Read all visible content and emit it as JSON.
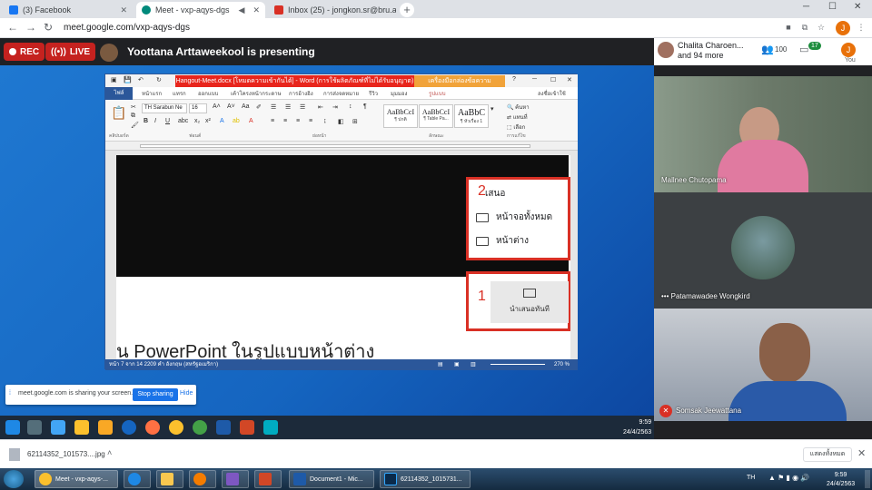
{
  "browser": {
    "tabs": [
      {
        "title": "(3) Facebook",
        "color": "#1877f2"
      },
      {
        "title": "Meet - vxp-aqys-dgs",
        "color": "#00897b"
      },
      {
        "title": "Inbox (25) - jongkon.sr@bru.ac.th",
        "color": "#d93025"
      }
    ],
    "url": "meet.google.com/vxp-aqys-dgs",
    "profile_initial": "J"
  },
  "meet": {
    "rec_label": "REC",
    "live_label": "LIVE",
    "presenter_text": "Yoottana Arttaweekool is presenting",
    "top_participant": "Chalita Charoen...",
    "others_count": "and 94 more",
    "people_count": "100",
    "chat_count": "17",
    "you_label": "You",
    "you_initial": "J",
    "participants": [
      {
        "name": "Mallnee Chutopama"
      },
      {
        "name": "Patamawadee Wongkird"
      },
      {
        "name": "Somsak Jeewattana"
      }
    ]
  },
  "word": {
    "title": "Hangout-Meet.docx [โหมดความเข้ากันได้] - Word (การใช้ผลิตภัณฑ์ที่ไม่ได้รับอนุญาต)",
    "context_tab": "เครื่องมือกล่องข้อความ",
    "tabs": [
      "ไฟล์",
      "หน้าแรก",
      "แทรก",
      "ออกแบบ",
      "เค้าโครงหน้ากระดาษ",
      "การอ้างอิง",
      "การส่งจดหมาย",
      "รีวิว",
      "มุมมอง",
      "รูปแบบ"
    ],
    "signin": "ลงชื่อเข้าใช้",
    "font": "TH Sarabun Ne",
    "font_size": "16",
    "styles": [
      {
        "sample": "AaBbCcI",
        "name": "¶ ปกติ"
      },
      {
        "sample": "AaBbCcI",
        "name": "¶ Table Pa..."
      },
      {
        "sample": "AaBbC",
        "name": "¶ หัวเรื่อง 1"
      }
    ],
    "group_labels": [
      "คลิปบอร์ด",
      "ฟอนต์",
      "ย่อหน้า",
      "ลักษณะ",
      "การแก้ไข"
    ],
    "edit_items": [
      "ค้นหา",
      "แทนที่",
      "เลือก"
    ],
    "menu2_number": "2",
    "menu2_header": "เสนอ",
    "menu2_items": [
      "หน้าจอทั้งหมด",
      "หน้าต่าง"
    ],
    "menu1_number": "1",
    "menu1_label": "นำเสนอทันที",
    "body_text": "น PowerPoint ในรูปแบบหน้าต่าง",
    "status": "หน้า 7 จาก 14    2209 คำ    อังกฤษ (สหรัฐอเมริกา)",
    "zoom": "270 %"
  },
  "share_bar": {
    "text": "meet.google.com is sharing your screen.",
    "stop": "Stop sharing",
    "hide": "Hide"
  },
  "inner_clock": {
    "time": "9:59",
    "date": "24/4/2563"
  },
  "download": {
    "filename": "62114352_101573....jpg",
    "show_all": "แสดงทั้งหมด"
  },
  "taskbar": {
    "items": [
      "Meet - vxp-aqys-...",
      "Document1 - Mic...",
      "62114352_1015731..."
    ],
    "lang": "TH",
    "time": "9:59",
    "date": "24/4/2563"
  }
}
